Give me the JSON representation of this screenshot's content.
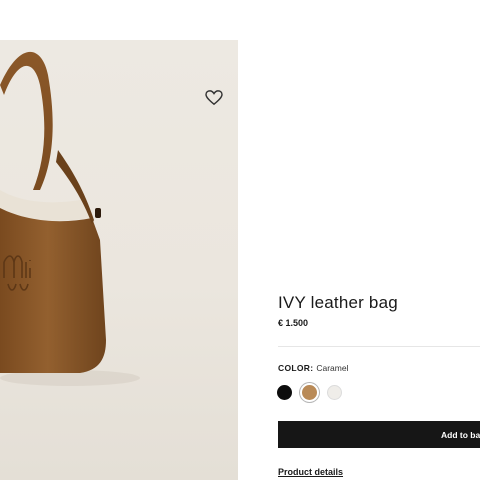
{
  "product": {
    "title": "IVY leather bag",
    "price": "€ 1.500"
  },
  "color": {
    "label": "COLOR:",
    "value": "Caramel",
    "swatches": [
      {
        "name": "black",
        "hex": "#0d0d0d"
      },
      {
        "name": "caramel",
        "hex": "#b98a57",
        "selected": true
      },
      {
        "name": "white",
        "hex": "#efede9"
      }
    ]
  },
  "actions": {
    "add_to_bag": "Add to ba",
    "product_details": "Product details"
  },
  "icons": {
    "wishlist": "heart-icon"
  },
  "colors": {
    "image_background": "#ebe6de",
    "leather": "#8a5626",
    "button": "#161616"
  }
}
